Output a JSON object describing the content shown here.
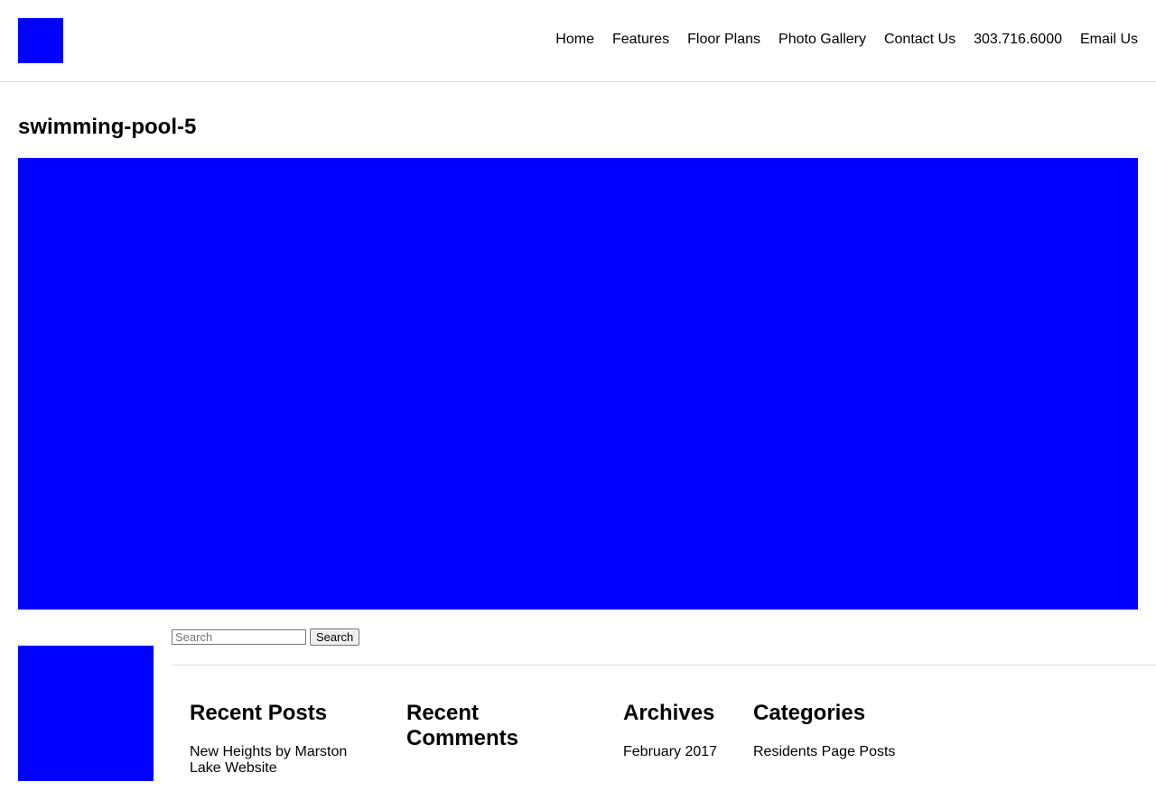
{
  "colors": {
    "image_placeholder": "#0000ff",
    "divider": "#dddddd",
    "text": "#000000"
  },
  "header": {
    "nav": [
      {
        "label": "Home"
      },
      {
        "label": "Features"
      },
      {
        "label": "Floor Plans"
      },
      {
        "label": "Photo Gallery"
      },
      {
        "label": "Contact Us"
      },
      {
        "label": "303.716.6000"
      },
      {
        "label": "Email Us"
      }
    ]
  },
  "main": {
    "title": "swimming-pool-5"
  },
  "footer": {
    "search": {
      "placeholder": "Search",
      "button_label": "Search"
    },
    "widgets": {
      "recent_posts": {
        "title": "Recent Posts",
        "items": [
          "New Heights by Marston Lake Website"
        ]
      },
      "recent_comments": {
        "title": "Recent Comments"
      },
      "archives": {
        "title": "Archives",
        "items": [
          "February 2017"
        ]
      },
      "categories": {
        "title": "Categories",
        "items": [
          "Residents Page Posts"
        ]
      }
    }
  }
}
